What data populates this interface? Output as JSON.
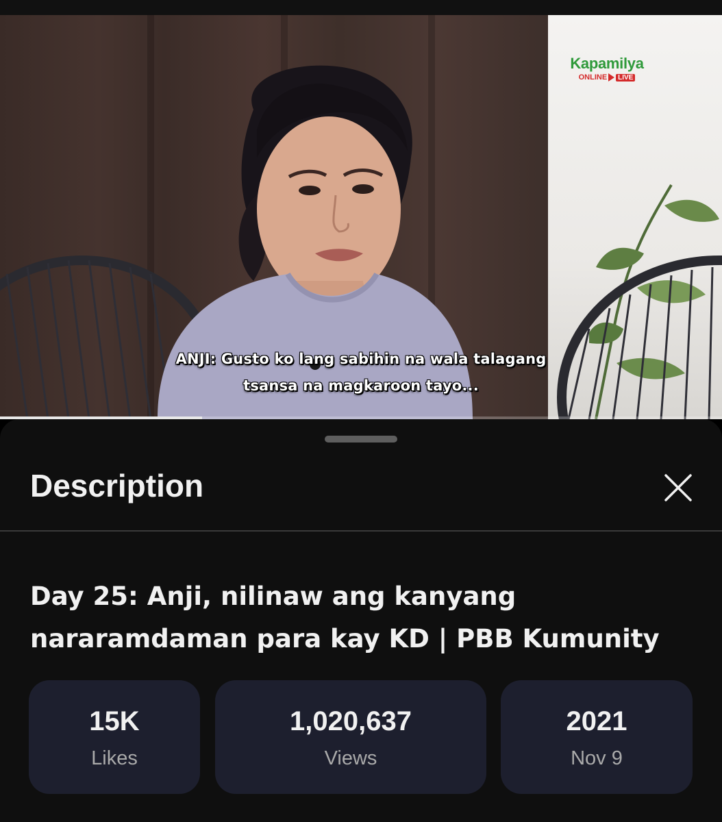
{
  "video": {
    "logo_main": "Kapamilya",
    "logo_online": "ONLINE",
    "logo_live": "LIVE",
    "caption_line1": "ANJI: Gusto ko lang sabihin na wala talagang",
    "caption_line2": "tsansa na magkaroon tayo...",
    "progress_percent": 28
  },
  "sheet": {
    "title": "Description",
    "close_icon": "close-icon",
    "video_title_line1": "Day 25: Anji, nilinaw ang kanyang",
    "video_title_line2": "nararamdaman para kay KD | PBB Kumunity"
  },
  "stats": {
    "likes_value": "15K",
    "likes_label": "Likes",
    "views_value": "1,020,637",
    "views_label": "Views",
    "year_value": "2021",
    "date_label": "Nov 9"
  },
  "colors": {
    "sheet_bg": "#0f0f0f",
    "stat_card_bg": "#1d1f2e",
    "brand_green": "#2f9a3a",
    "live_red": "#d42a2a"
  }
}
